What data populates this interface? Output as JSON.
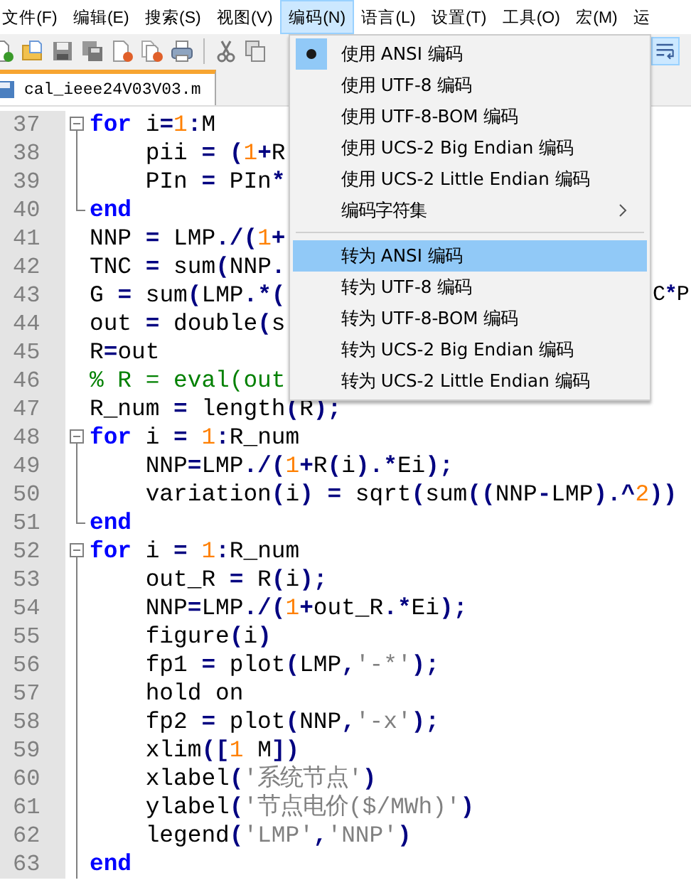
{
  "menubar": [
    {
      "label": "文件(F)",
      "selected": false
    },
    {
      "label": "编辑(E)",
      "selected": false
    },
    {
      "label": "搜索(S)",
      "selected": false
    },
    {
      "label": "视图(V)",
      "selected": false
    },
    {
      "label": "编码(N)",
      "selected": true
    },
    {
      "label": "语言(L)",
      "selected": false
    },
    {
      "label": "设置(T)",
      "selected": false
    },
    {
      "label": "工具(O)",
      "selected": false
    },
    {
      "label": "宏(M)",
      "selected": false
    },
    {
      "label": "运",
      "selected": false
    }
  ],
  "tab": {
    "label": "cal_ieee24V03V03.m"
  },
  "editor": {
    "lines": [
      {
        "number": "37",
        "fold": {
          "kind": "start"
        },
        "tokens": [
          {
            "kind": "keyword",
            "text": "for"
          },
          {
            "kind": "plain",
            "text": " i"
          },
          {
            "kind": "operator",
            "text": "="
          },
          {
            "kind": "number",
            "text": "1"
          },
          {
            "kind": "operator",
            "text": ":"
          },
          {
            "kind": "plain",
            "text": "M"
          }
        ]
      },
      {
        "number": "38",
        "fold": {
          "kind": "body"
        },
        "tokens": [
          {
            "kind": "plain",
            "text": "    pii "
          },
          {
            "kind": "operator",
            "text": "= ("
          },
          {
            "kind": "number",
            "text": "1"
          },
          {
            "kind": "operator",
            "text": "+"
          },
          {
            "kind": "plain",
            "text": "R"
          }
        ]
      },
      {
        "number": "39",
        "fold": {
          "kind": "body"
        },
        "tokens": [
          {
            "kind": "plain",
            "text": "    PIn "
          },
          {
            "kind": "operator",
            "text": "="
          },
          {
            "kind": "plain",
            "text": " PIn"
          },
          {
            "kind": "operator",
            "text": "*"
          }
        ]
      },
      {
        "number": "40",
        "fold": {
          "kind": "end"
        },
        "tokens": [
          {
            "kind": "keyword",
            "text": "end"
          }
        ]
      },
      {
        "number": "41",
        "tokens": [
          {
            "kind": "plain",
            "text": "NNP "
          },
          {
            "kind": "operator",
            "text": "="
          },
          {
            "kind": "plain",
            "text": " LMP"
          },
          {
            "kind": "operator",
            "text": "./("
          },
          {
            "kind": "number",
            "text": "1"
          },
          {
            "kind": "operator",
            "text": "+"
          }
        ]
      },
      {
        "number": "42",
        "tokens": [
          {
            "kind": "plain",
            "text": "TNC "
          },
          {
            "kind": "operator",
            "text": "="
          },
          {
            "kind": "plain",
            "text": " sum"
          },
          {
            "kind": "operator",
            "text": "("
          },
          {
            "kind": "plain",
            "text": "NNP"
          },
          {
            "kind": "operator",
            "text": "."
          }
        ]
      },
      {
        "number": "43",
        "tokens": [
          {
            "kind": "plain",
            "text": "G "
          },
          {
            "kind": "operator",
            "text": "="
          },
          {
            "kind": "plain",
            "text": " sum"
          },
          {
            "kind": "operator",
            "text": "("
          },
          {
            "kind": "plain",
            "text": "LMP"
          },
          {
            "kind": "operator",
            "text": ".*("
          }
        ],
        "tail": [
          {
            "kind": "plain",
            "text": "C"
          },
          {
            "kind": "operator",
            "text": "*"
          },
          {
            "kind": "plain",
            "text": "P"
          }
        ]
      },
      {
        "number": "44",
        "tokens": [
          {
            "kind": "plain",
            "text": "out "
          },
          {
            "kind": "operator",
            "text": "="
          },
          {
            "kind": "plain",
            "text": " double"
          },
          {
            "kind": "operator",
            "text": "("
          },
          {
            "kind": "plain",
            "text": "s"
          }
        ]
      },
      {
        "number": "45",
        "tokens": [
          {
            "kind": "plain",
            "text": "R"
          },
          {
            "kind": "operator",
            "text": "="
          },
          {
            "kind": "plain",
            "text": "out"
          }
        ]
      },
      {
        "number": "46",
        "tokens": [
          {
            "kind": "comment",
            "text": "% R = eval(out"
          }
        ]
      },
      {
        "number": "47",
        "tokens": [
          {
            "kind": "plain",
            "text": "R_num "
          },
          {
            "kind": "operator",
            "text": "="
          },
          {
            "kind": "plain",
            "text": " length"
          },
          {
            "kind": "operator",
            "text": "("
          },
          {
            "kind": "plain",
            "text": "R"
          },
          {
            "kind": "operator",
            "text": ");"
          }
        ]
      },
      {
        "number": "48",
        "fold": {
          "kind": "start"
        },
        "tokens": [
          {
            "kind": "keyword",
            "text": "for"
          },
          {
            "kind": "plain",
            "text": " i "
          },
          {
            "kind": "operator",
            "text": "= "
          },
          {
            "kind": "number",
            "text": "1"
          },
          {
            "kind": "operator",
            "text": ":"
          },
          {
            "kind": "plain",
            "text": "R_num"
          }
        ]
      },
      {
        "number": "49",
        "fold": {
          "kind": "body"
        },
        "tokens": [
          {
            "kind": "plain",
            "text": "    NNP"
          },
          {
            "kind": "operator",
            "text": "="
          },
          {
            "kind": "plain",
            "text": "LMP"
          },
          {
            "kind": "operator",
            "text": "./("
          },
          {
            "kind": "number",
            "text": "1"
          },
          {
            "kind": "operator",
            "text": "+"
          },
          {
            "kind": "plain",
            "text": "R"
          },
          {
            "kind": "operator",
            "text": "("
          },
          {
            "kind": "plain",
            "text": "i"
          },
          {
            "kind": "operator",
            "text": ").*"
          },
          {
            "kind": "plain",
            "text": "Ei"
          },
          {
            "kind": "operator",
            "text": ");"
          }
        ]
      },
      {
        "number": "50",
        "fold": {
          "kind": "body"
        },
        "tokens": [
          {
            "kind": "plain",
            "text": "    variation"
          },
          {
            "kind": "operator",
            "text": "("
          },
          {
            "kind": "plain",
            "text": "i"
          },
          {
            "kind": "operator",
            "text": ") ="
          },
          {
            "kind": "plain",
            "text": " sqrt"
          },
          {
            "kind": "operator",
            "text": "("
          },
          {
            "kind": "plain",
            "text": "sum"
          },
          {
            "kind": "operator",
            "text": "(("
          },
          {
            "kind": "plain",
            "text": "NNP"
          },
          {
            "kind": "operator",
            "text": "-"
          },
          {
            "kind": "plain",
            "text": "LMP"
          },
          {
            "kind": "operator",
            "text": ").^"
          },
          {
            "kind": "number",
            "text": "2"
          },
          {
            "kind": "operator",
            "text": "))"
          }
        ]
      },
      {
        "number": "51",
        "fold": {
          "kind": "end"
        },
        "tokens": [
          {
            "kind": "keyword",
            "text": "end"
          }
        ]
      },
      {
        "number": "52",
        "fold": {
          "kind": "start"
        },
        "tokens": [
          {
            "kind": "keyword",
            "text": "for"
          },
          {
            "kind": "plain",
            "text": " i "
          },
          {
            "kind": "operator",
            "text": "= "
          },
          {
            "kind": "number",
            "text": "1"
          },
          {
            "kind": "operator",
            "text": ":"
          },
          {
            "kind": "plain",
            "text": "R_num"
          }
        ]
      },
      {
        "number": "53",
        "fold": {
          "kind": "body"
        },
        "tokens": [
          {
            "kind": "plain",
            "text": "    out_R "
          },
          {
            "kind": "operator",
            "text": "="
          },
          {
            "kind": "plain",
            "text": " R"
          },
          {
            "kind": "operator",
            "text": "("
          },
          {
            "kind": "plain",
            "text": "i"
          },
          {
            "kind": "operator",
            "text": ");"
          }
        ]
      },
      {
        "number": "54",
        "fold": {
          "kind": "body"
        },
        "tokens": [
          {
            "kind": "plain",
            "text": "    NNP"
          },
          {
            "kind": "operator",
            "text": "="
          },
          {
            "kind": "plain",
            "text": "LMP"
          },
          {
            "kind": "operator",
            "text": "./("
          },
          {
            "kind": "number",
            "text": "1"
          },
          {
            "kind": "operator",
            "text": "+"
          },
          {
            "kind": "plain",
            "text": "out_R"
          },
          {
            "kind": "operator",
            "text": ".*"
          },
          {
            "kind": "plain",
            "text": "Ei"
          },
          {
            "kind": "operator",
            "text": ");"
          }
        ]
      },
      {
        "number": "55",
        "fold": {
          "kind": "body"
        },
        "tokens": [
          {
            "kind": "plain",
            "text": "    figure"
          },
          {
            "kind": "operator",
            "text": "("
          },
          {
            "kind": "plain",
            "text": "i"
          },
          {
            "kind": "operator",
            "text": ")"
          }
        ]
      },
      {
        "number": "56",
        "fold": {
          "kind": "body"
        },
        "tokens": [
          {
            "kind": "plain",
            "text": "    fp1 "
          },
          {
            "kind": "operator",
            "text": "="
          },
          {
            "kind": "plain",
            "text": " plot"
          },
          {
            "kind": "operator",
            "text": "("
          },
          {
            "kind": "plain",
            "text": "LMP"
          },
          {
            "kind": "operator",
            "text": ","
          },
          {
            "kind": "string",
            "text": "'-*'"
          },
          {
            "kind": "operator",
            "text": ");"
          }
        ]
      },
      {
        "number": "57",
        "fold": {
          "kind": "body"
        },
        "tokens": [
          {
            "kind": "plain",
            "text": "    hold on"
          }
        ]
      },
      {
        "number": "58",
        "fold": {
          "kind": "body"
        },
        "tokens": [
          {
            "kind": "plain",
            "text": "    fp2 "
          },
          {
            "kind": "operator",
            "text": "="
          },
          {
            "kind": "plain",
            "text": " plot"
          },
          {
            "kind": "operator",
            "text": "("
          },
          {
            "kind": "plain",
            "text": "NNP"
          },
          {
            "kind": "operator",
            "text": ","
          },
          {
            "kind": "string",
            "text": "'-x'"
          },
          {
            "kind": "operator",
            "text": ");"
          }
        ]
      },
      {
        "number": "59",
        "fold": {
          "kind": "body"
        },
        "tokens": [
          {
            "kind": "plain",
            "text": "    xlim"
          },
          {
            "kind": "operator",
            "text": "(["
          },
          {
            "kind": "number",
            "text": "1"
          },
          {
            "kind": "plain",
            "text": " M"
          },
          {
            "kind": "operator",
            "text": "])"
          }
        ]
      },
      {
        "number": "60",
        "fold": {
          "kind": "body"
        },
        "tokens": [
          {
            "kind": "plain",
            "text": "    xlabel"
          },
          {
            "kind": "operator",
            "text": "("
          },
          {
            "kind": "string",
            "text": "'系统节点'"
          },
          {
            "kind": "operator",
            "text": ")"
          }
        ]
      },
      {
        "number": "61",
        "fold": {
          "kind": "body"
        },
        "tokens": [
          {
            "kind": "plain",
            "text": "    ylabel"
          },
          {
            "kind": "operator",
            "text": "("
          },
          {
            "kind": "string",
            "text": "'节点电价($/MWh)'"
          },
          {
            "kind": "operator",
            "text": ")"
          }
        ]
      },
      {
        "number": "62",
        "fold": {
          "kind": "body"
        },
        "tokens": [
          {
            "kind": "plain",
            "text": "    legend"
          },
          {
            "kind": "operator",
            "text": "("
          },
          {
            "kind": "string",
            "text": "'LMP'"
          },
          {
            "kind": "operator",
            "text": ","
          },
          {
            "kind": "string",
            "text": "'NNP'"
          },
          {
            "kind": "operator",
            "text": ")"
          }
        ]
      },
      {
        "number": "63",
        "fold": {
          "kind": "body"
        },
        "tokens": [
          {
            "kind": "keyword",
            "text": "end"
          }
        ]
      }
    ]
  },
  "dropdown": {
    "items": [
      {
        "kind": "item",
        "label": "使用 ANSI 编码",
        "checked": true,
        "selected": false
      },
      {
        "kind": "item",
        "label": "使用 UTF-8 编码",
        "checked": false,
        "selected": false
      },
      {
        "kind": "item",
        "label": "使用 UTF-8-BOM 编码",
        "checked": false,
        "selected": false
      },
      {
        "kind": "item",
        "label": "使用 UCS-2 Big Endian 编码",
        "checked": false,
        "selected": false
      },
      {
        "kind": "item",
        "label": "使用 UCS-2 Little Endian 编码",
        "checked": false,
        "selected": false
      },
      {
        "kind": "submenu",
        "label": "编码字符集",
        "checked": false,
        "selected": false
      },
      {
        "kind": "separator"
      },
      {
        "kind": "item",
        "label": "转为 ANSI 编码",
        "checked": false,
        "selected": true
      },
      {
        "kind": "item",
        "label": "转为 UTF-8 编码",
        "checked": false,
        "selected": false
      },
      {
        "kind": "item",
        "label": "转为 UTF-8-BOM 编码",
        "checked": false,
        "selected": false
      },
      {
        "kind": "item",
        "label": "转为 UCS-2 Big Endian 编码",
        "checked": false,
        "selected": false
      },
      {
        "kind": "item",
        "label": "转为 UCS-2 Little Endian 编码",
        "checked": false,
        "selected": false
      }
    ]
  }
}
